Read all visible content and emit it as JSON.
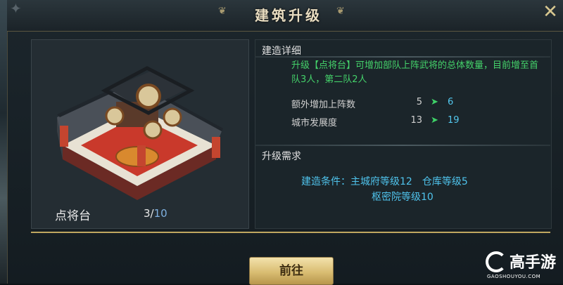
{
  "window": {
    "title": "建筑升级",
    "close_icon": "close-icon"
  },
  "building": {
    "name": "点将台",
    "level_current": "3",
    "level_separator": "/",
    "level_max": "10"
  },
  "details": {
    "heading": "建造详细",
    "description": "升级【点将台】可增加部队上阵武将的总体数量，目前增至首队3人，第二队2人",
    "stats": [
      {
        "label": "额外增加上阵数",
        "from": "5",
        "arrow": "➤",
        "to": "6"
      },
      {
        "label": "城市发展度",
        "from": "13",
        "arrow": "➤",
        "to": "19"
      }
    ]
  },
  "requirements": {
    "heading": "升级需求",
    "line1": "建造条件：主城府等级12　仓库等级5",
    "line2": "枢密院等级10"
  },
  "action": {
    "go_label": "前往"
  },
  "watermark": {
    "brand": "高手游",
    "domain": "GAOSHOUYOU.COM"
  },
  "colors": {
    "accent_gold": "#c0a760",
    "text_green": "#44d16a",
    "text_blue": "#53c8ef"
  }
}
